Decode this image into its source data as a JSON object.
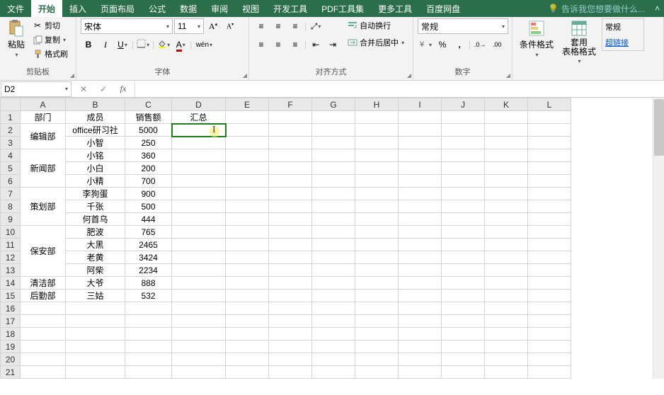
{
  "tabs": {
    "file": "文件",
    "items": [
      "开始",
      "插入",
      "页面布局",
      "公式",
      "数据",
      "审阅",
      "视图",
      "开发工具",
      "PDF工具集",
      "更多工具",
      "百度网盘"
    ],
    "active": "开始",
    "hint": "告诉我您想要做什么..."
  },
  "ribbon": {
    "clipboard": {
      "paste": "粘贴",
      "cut": "剪切",
      "copy": "复制",
      "format_painter": "格式刷",
      "label": "剪贴板"
    },
    "font": {
      "name": "宋体",
      "size": "11",
      "bold": "B",
      "italic": "I",
      "underline": "U",
      "phonetic": "wén",
      "label": "字体"
    },
    "align": {
      "wrap": "自动换行",
      "merge": "合并后居中",
      "label": "对齐方式"
    },
    "number": {
      "format": "常规",
      "label": "数字"
    },
    "styles": {
      "cond": "条件格式",
      "table": "套用\n表格格式",
      "general": "常规",
      "hyperlink": "超链接"
    }
  },
  "fbar": {
    "name": "D2",
    "cancel": "✕",
    "enter": "✓",
    "fx": "fx",
    "value": ""
  },
  "cols": [
    "A",
    "B",
    "C",
    "D",
    "E",
    "F",
    "G",
    "H",
    "I",
    "J",
    "K",
    "L"
  ],
  "rows": 21,
  "data": {
    "headers": [
      "部门",
      "成员",
      "销售额",
      "汇总"
    ],
    "body": [
      {
        "dept": "编辑部",
        "rs": 2,
        "members": [
          [
            "office研习社",
            "5000"
          ],
          [
            "小智",
            "250"
          ]
        ]
      },
      {
        "dept": "新闻部",
        "rs": 3,
        "members": [
          [
            "小铭",
            "360"
          ],
          [
            "小白",
            "200"
          ],
          [
            "小精",
            "700"
          ]
        ]
      },
      {
        "dept": "策划部",
        "rs": 3,
        "members": [
          [
            "李狗蛋",
            "900"
          ],
          [
            "千张",
            "500"
          ],
          [
            "何首乌",
            "444"
          ]
        ]
      },
      {
        "dept": "保安部",
        "rs": 4,
        "members": [
          [
            "肥波",
            "765"
          ],
          [
            "大黑",
            "2465"
          ],
          [
            "老黄",
            "3424"
          ],
          [
            "阿柴",
            "2234"
          ]
        ]
      },
      {
        "dept": "清洁部",
        "rs": 1,
        "members": [
          [
            "大爷",
            "888"
          ]
        ]
      },
      {
        "dept": "后勤部",
        "rs": 1,
        "members": [
          [
            "三姑",
            "532"
          ]
        ]
      }
    ]
  },
  "active_cell": "D2"
}
